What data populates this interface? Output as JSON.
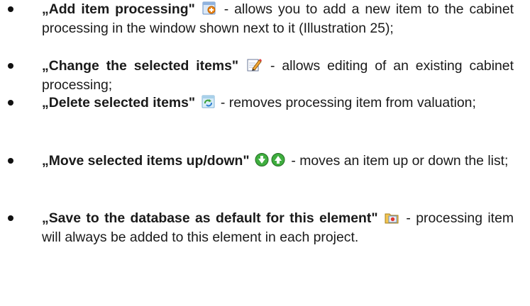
{
  "items": [
    {
      "title": "„Add item processing\"",
      "icon": "add-item-icon",
      "desc": " - allows you to add a new item to the cabinet processing in the window shown next to it (Illustration  25);"
    },
    {
      "title": "„Change the selected items\"",
      "icon": "edit-pencil-icon",
      "desc": " - allows editing of an existing cabinet processing;"
    },
    {
      "title": "„Delete selected items\"",
      "icon": "delete-item-icon",
      "desc": " - removes processing item from valuation;"
    },
    {
      "title": "„Move selected items up/down\"",
      "icon": "move-down-up-icons",
      "desc": " - moves an item up or down the list;"
    },
    {
      "title": "„Save to the database as default for this element\"",
      "icon": "save-database-icon",
      "desc": " - processing item will always be added to this element in each project."
    }
  ]
}
